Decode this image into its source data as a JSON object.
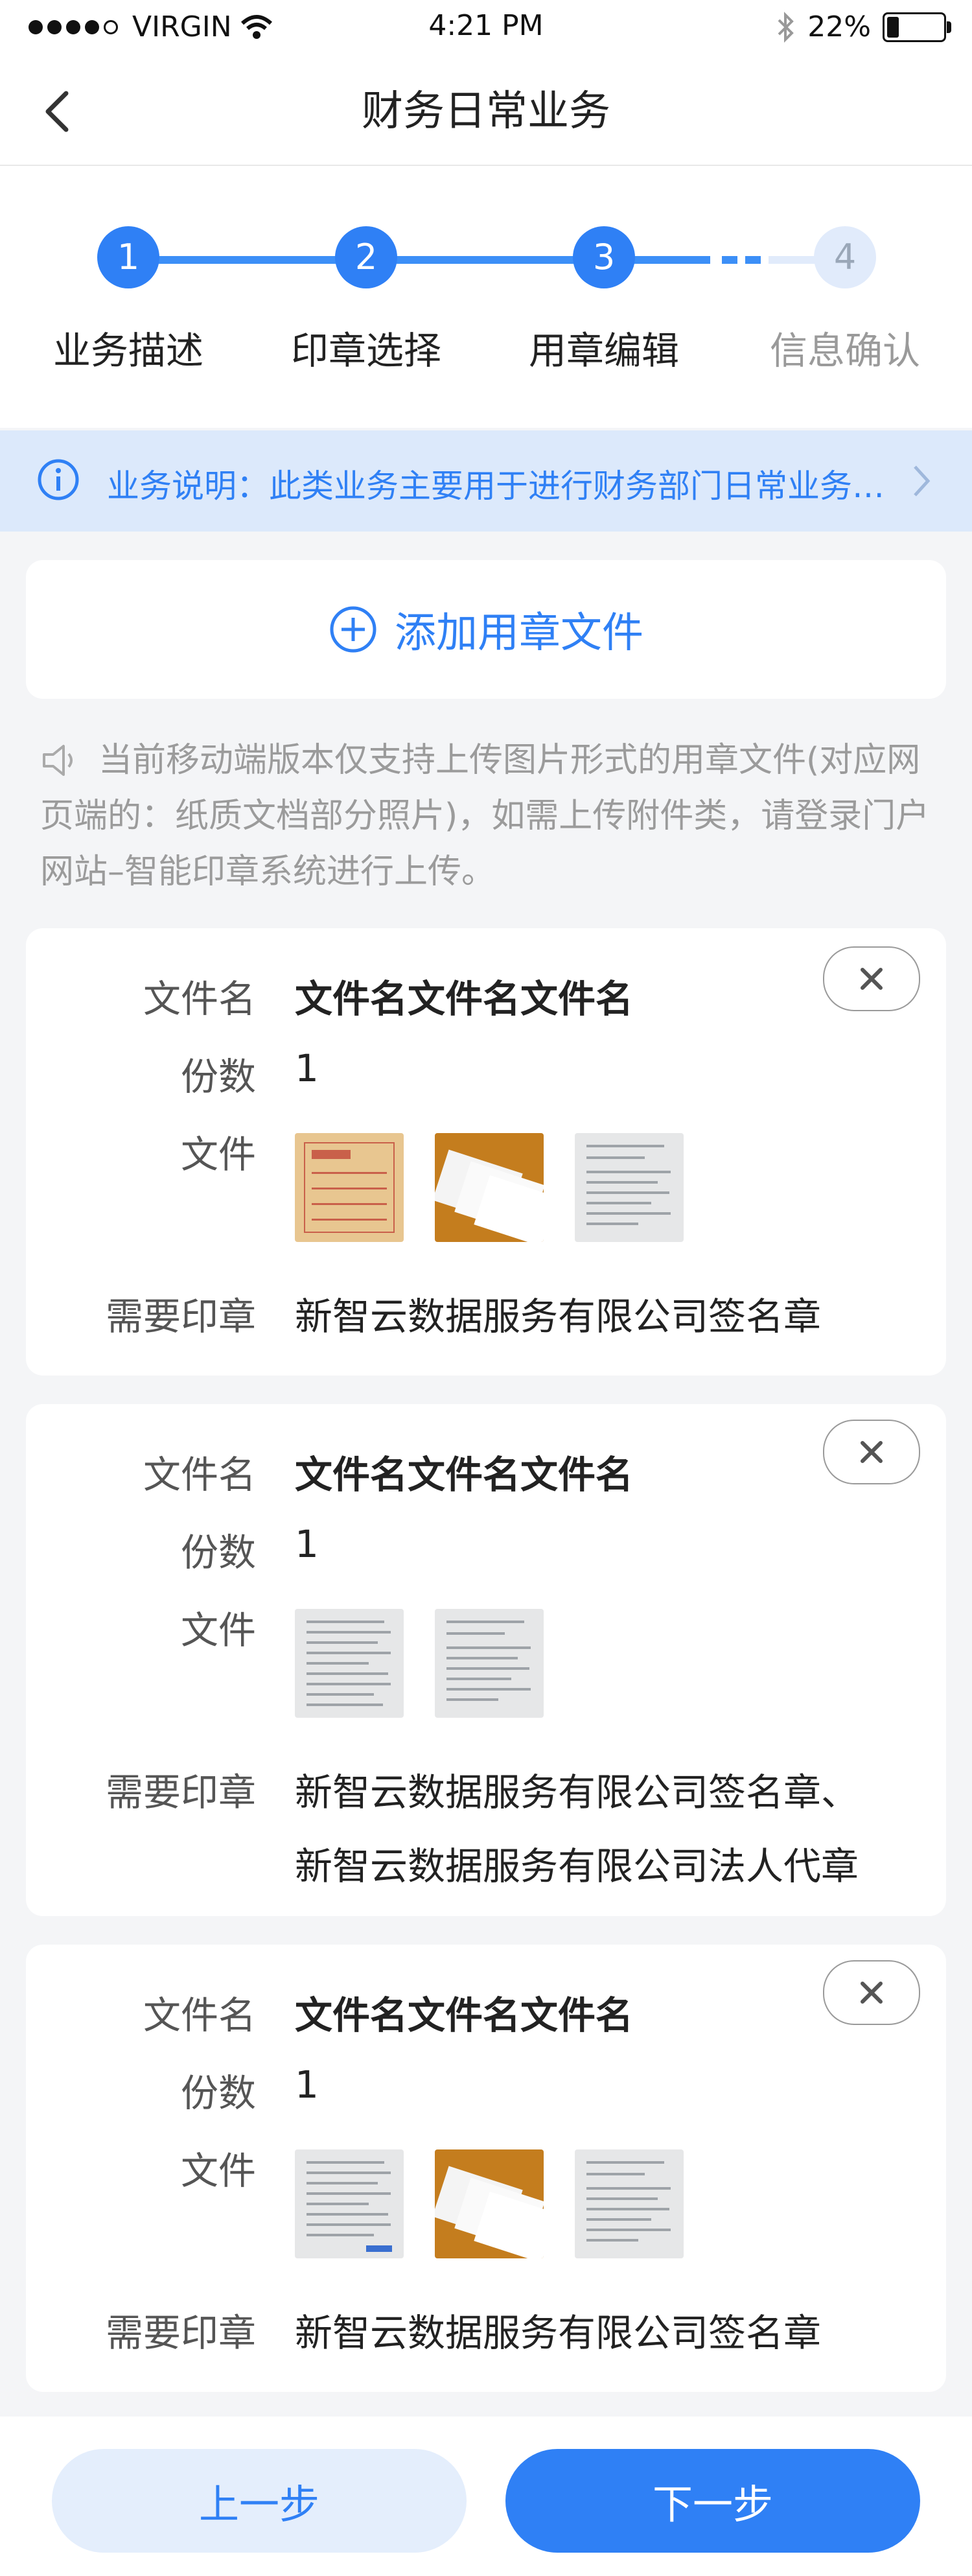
{
  "status_bar": {
    "carrier": "VIRGIN",
    "time": "4:21 PM",
    "battery": "22%",
    "battery_level": 0.22,
    "icons": [
      "signal-dots-icon",
      "wifi-icon",
      "bluetooth-icon",
      "battery-icon"
    ]
  },
  "nav": {
    "title": "财务日常业务",
    "back_icon": "chevron-left-icon"
  },
  "steps": [
    {
      "number": "1",
      "label": "业务描述",
      "state": "done"
    },
    {
      "number": "2",
      "label": "印章选择",
      "state": "done"
    },
    {
      "number": "3",
      "label": "用章编辑",
      "state": "current"
    },
    {
      "number": "4",
      "label": "信息确认",
      "state": "pending"
    }
  ],
  "notice": {
    "text": "业务说明：此类业务主要用于进行财务部门日常业务…",
    "icon": "info-icon",
    "arrow_icon": "chevron-right-icon"
  },
  "add_file": {
    "label": "添加用章文件",
    "icon": "plus-circle-icon"
  },
  "tip": {
    "icon": "speaker-icon",
    "text": "当前移动端版本仅支持上传图片形式的用章文件(对应网页端的：纸质文档部分照片)，如需上传附件类，请登录门户网站–智能印章系统进行上传。"
  },
  "field_labels": {
    "name": "文件名",
    "copies": "份数",
    "files": "文件",
    "seals": "需要印章"
  },
  "files": [
    {
      "name": "文件名文件名文件名",
      "copies": "1",
      "thumbnails": [
        "archive-folder-photo",
        "printed-documents-photo",
        "document-page-scan"
      ],
      "seals": [
        "新智云数据服务有限公司签名章"
      ]
    },
    {
      "name": "文件名文件名文件名",
      "copies": "1",
      "thumbnails": [
        "document-page-scan",
        "document-page-scan"
      ],
      "seals": [
        "新智云数据服务有限公司签名章、",
        "新智云数据服务有限公司法人代章"
      ]
    },
    {
      "name": "文件名文件名文件名",
      "copies": "1",
      "thumbnails": [
        "document-page-scan",
        "printed-documents-photo",
        "document-page-scan"
      ],
      "seals": [
        "新智云数据服务有限公司签名章"
      ]
    }
  ],
  "buttons": {
    "prev": "上一步",
    "next": "下一步"
  },
  "colors": {
    "primary": "#2f80f5",
    "notice_bg": "#dce9fb",
    "page_bg": "#f4f5f7"
  }
}
